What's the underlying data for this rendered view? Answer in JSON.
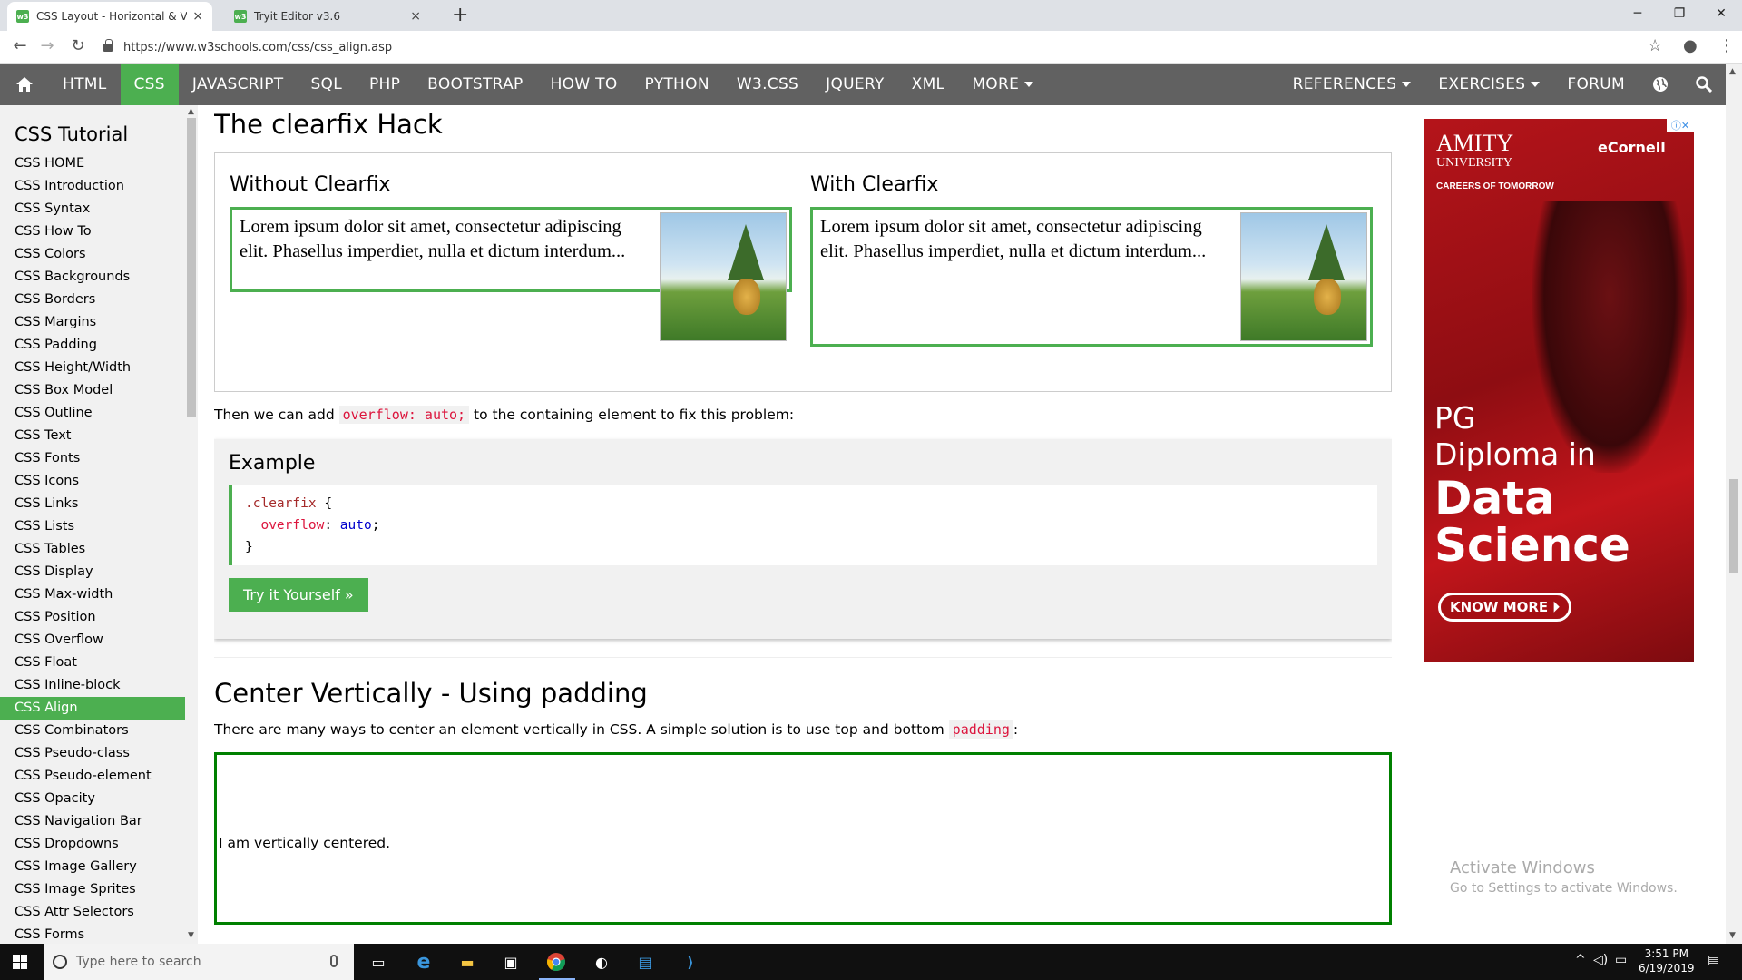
{
  "browser": {
    "tabs": [
      {
        "title": "CSS Layout - Horizontal & Vertic",
        "active": true
      },
      {
        "title": "Tryit Editor v3.6",
        "active": false
      }
    ],
    "favicon": "w3",
    "url": "https://www.w3schools.com/css/css_align.asp",
    "new_tab": "+",
    "close": "×"
  },
  "topnav": {
    "home_icon": "home-icon",
    "items": [
      "HTML",
      "CSS",
      "JAVASCRIPT",
      "SQL",
      "PHP",
      "BOOTSTRAP",
      "HOW TO",
      "PYTHON",
      "W3.CSS",
      "JQUERY",
      "XML",
      "MORE"
    ],
    "active": "CSS",
    "right_items": [
      "REFERENCES",
      "EXERCISES",
      "FORUM"
    ],
    "accent": "#4caf50",
    "bg": "#616161"
  },
  "sidebar": {
    "title": "CSS Tutorial",
    "items": [
      "CSS HOME",
      "CSS Introduction",
      "CSS Syntax",
      "CSS How To",
      "CSS Colors",
      "CSS Backgrounds",
      "CSS Borders",
      "CSS Margins",
      "CSS Padding",
      "CSS Height/Width",
      "CSS Box Model",
      "CSS Outline",
      "CSS Text",
      "CSS Fonts",
      "CSS Icons",
      "CSS Links",
      "CSS Lists",
      "CSS Tables",
      "CSS Display",
      "CSS Max-width",
      "CSS Position",
      "CSS Overflow",
      "CSS Float",
      "CSS Inline-block",
      "CSS Align",
      "CSS Combinators",
      "CSS Pseudo-class",
      "CSS Pseudo-element",
      "CSS Opacity",
      "CSS Navigation Bar",
      "CSS Dropdowns",
      "CSS Image Gallery",
      "CSS Image Sprites",
      "CSS Attr Selectors",
      "CSS Forms"
    ],
    "active_item": "CSS Align"
  },
  "main": {
    "section_title": "The clearfix Hack",
    "demo": {
      "without_title": "Without Clearfix",
      "with_title": "With Clearfix",
      "lorem": "Lorem ipsum dolor sit amet, consectetur adipiscing elit. Phasellus imperdiet, nulla et dictum interdum..."
    },
    "fix_text_before": "Then we can add",
    "fix_code": "overflow: auto;",
    "fix_text_after": "to the containing element to fix this problem:",
    "example": {
      "title": "Example",
      "code_selector": ".clearfix",
      "code_open": "{",
      "code_prop": "overflow",
      "code_colon": ":",
      "code_value": "auto",
      "code_semicolon": ";",
      "code_close": "}",
      "button": "Try it Yourself »"
    },
    "section2_title": "Center Vertically - Using padding",
    "section2_text_before": "There are many ways to center an element vertically in CSS. A simple solution is to use top and bottom",
    "section2_code": "padding",
    "section2_text_after": ":",
    "centered_text": "I am vertically centered."
  },
  "ad": {
    "brand": "AMITY",
    "brand_sub": "UNIVERSITY",
    "brand_tag": "CAREERS OF TOMORROW",
    "partner": "eCornell",
    "line1": "PG",
    "line2": "Diploma in",
    "line3": "Data",
    "line4": "Science",
    "button": "KNOW MORE"
  },
  "watermark": {
    "title": "Activate Windows",
    "subtitle": "Go to Settings to activate Windows."
  },
  "taskbar": {
    "search_placeholder": "Type here to search",
    "time": "3:51 PM",
    "date": "6/19/2019"
  }
}
